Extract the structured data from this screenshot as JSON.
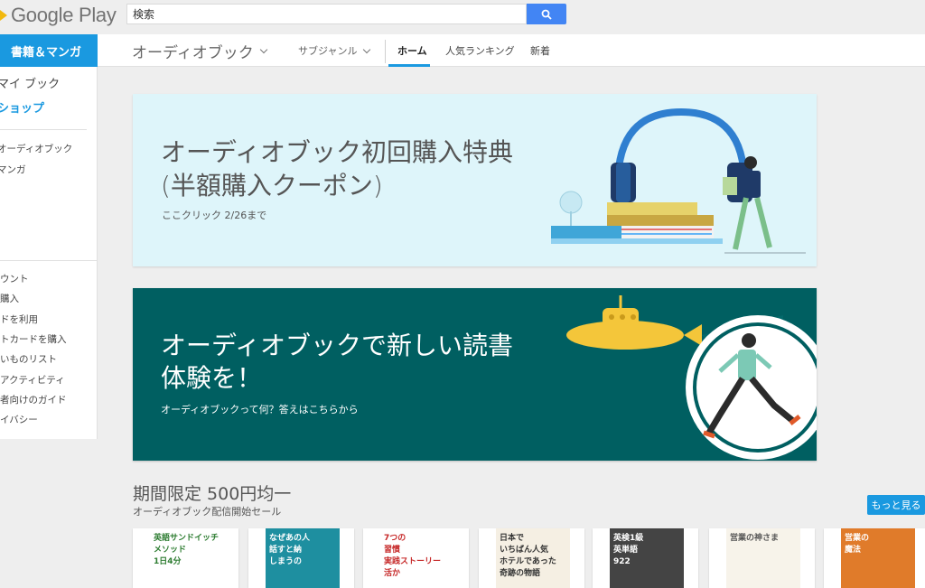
{
  "header": {
    "logo_text": "Google Play",
    "search_placeholder": "検索",
    "search_value": "検索"
  },
  "nav": {
    "section_tab": "書籍＆マンガ",
    "category_title": "オーディオブック",
    "subgenre": "サブジャンル",
    "tabs": [
      {
        "label": "ホーム",
        "active": true
      },
      {
        "label": "人気ランキング",
        "active": false
      },
      {
        "label": "新着",
        "active": false
      }
    ]
  },
  "sidebar": {
    "items": [
      "マイ ブック",
      "ショップ",
      "オーディオブック",
      "マンガ"
    ],
    "account_items": [
      "ウント",
      "購入",
      "ドを利用",
      "トカードを購入",
      "いものリスト",
      "アクティビティ",
      "者向けのガイド",
      "イバシー"
    ]
  },
  "banners": [
    {
      "title_line1": "オーディオブック初回購入特典",
      "title_line2": "(半額購入クーポン)",
      "cta": "ここクリック 2/26まで",
      "bg": "#def5fa"
    },
    {
      "title_line1": "オーディオブックで新しい読書",
      "title_line2": "体験を！",
      "cta": "オーディオブックって何？答えはこちらから",
      "bg": "#005f61"
    }
  ],
  "section": {
    "title": "期間限定 500円均一",
    "subtitle": "オーディオブック配信開始セール",
    "more_button": "もっと見る"
  },
  "books": [
    {
      "cover_lines": [
        "英語サンドイッチ",
        "メソッド",
        "1日4分"
      ],
      "bg": "#ffffff",
      "fg": "#2e7d32"
    },
    {
      "cover_lines": [
        "なぜあの人",
        "話すと納",
        "しまうの"
      ],
      "bg": "#1e8fa0",
      "fg": "#ffffff"
    },
    {
      "cover_lines": [
        "7つの",
        "習慣",
        "実践ストーリー",
        "活か"
      ],
      "bg": "#ffffff",
      "fg": "#c62828"
    },
    {
      "cover_lines": [
        "日本で",
        "いちばん人気",
        "ホテルであった",
        "奇跡の物語"
      ],
      "bg": "#f5efe3",
      "fg": "#333333"
    },
    {
      "cover_lines": [
        "英検1級",
        "英単語",
        "922"
      ],
      "bg": "#444444",
      "fg": "#ffffff"
    },
    {
      "cover_lines": [
        "営業の神さま"
      ],
      "bg": "#f7f3ea",
      "fg": "#555555"
    },
    {
      "cover_lines": [
        "営業の",
        "魔法"
      ],
      "bg": "#e07b2a",
      "fg": "#ffffff"
    }
  ]
}
